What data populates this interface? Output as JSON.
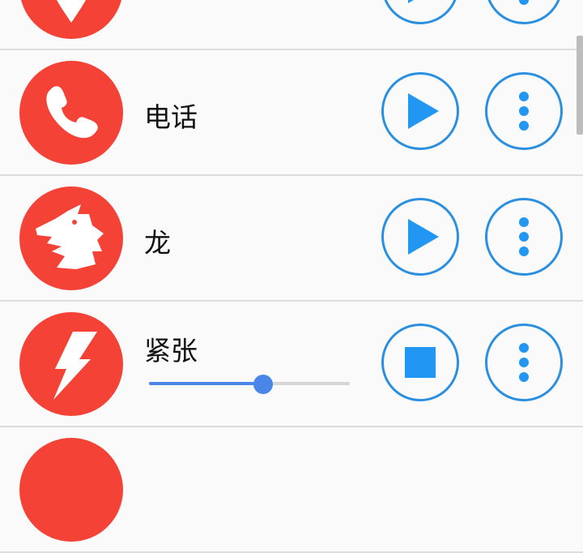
{
  "theme": {
    "accent": "#2196f3",
    "avatar_color": "#f44336"
  },
  "sounds": [
    {
      "title": "",
      "icon": "gem-icon",
      "state": "stopped"
    },
    {
      "title": "电话",
      "icon": "phone-icon",
      "state": "stopped"
    },
    {
      "title": "龙",
      "icon": "dragon-icon",
      "state": "stopped"
    },
    {
      "title": "紧张",
      "icon": "lightning-icon",
      "state": "playing",
      "volume": 0.57
    },
    {
      "title": "",
      "icon": "circle-icon",
      "state": "stopped"
    }
  ]
}
